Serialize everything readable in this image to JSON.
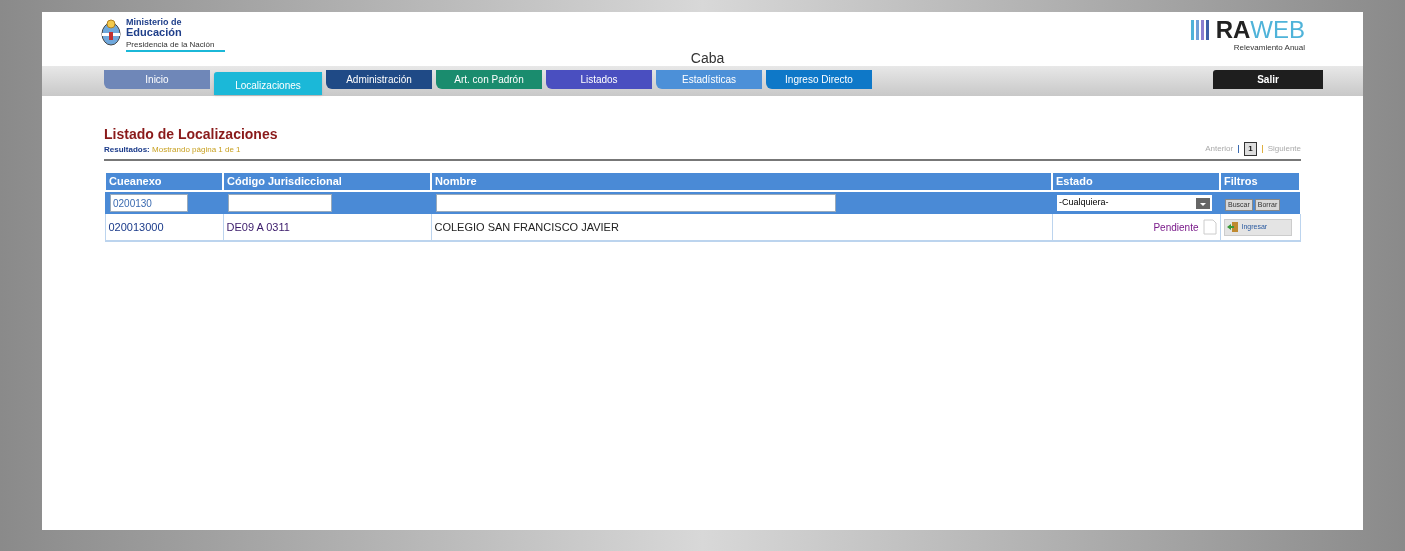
{
  "header": {
    "ministry_line1": "Ministerio de",
    "ministry_line2": "Educación",
    "ministry_line3": "Presidencia de la Nación",
    "title": "Caba",
    "brand_main": "RA",
    "brand_web": "WEB",
    "brand_sub": "Relevamiento Anual"
  },
  "tabs": [
    {
      "label": "Inicio",
      "color": "#6f87b8",
      "selected": false
    },
    {
      "label": "Localizaciones",
      "color": "#1bb8d8",
      "selected": true
    },
    {
      "label": "Administración",
      "color": "#1f4a86",
      "selected": false
    },
    {
      "label": "Art. con Padrón",
      "color": "#1a8c6e",
      "selected": false
    },
    {
      "label": "Listados",
      "color": "#4a4fc0",
      "selected": false
    },
    {
      "label": "Estadísticas",
      "color": "#4c90d8",
      "selected": false
    },
    {
      "label": "Ingreso Directo",
      "color": "#0e78c8",
      "selected": false
    }
  ],
  "logout": "Salir",
  "page_title": "Listado de Localizaciones",
  "results_label": "Resultados:",
  "results_text": "Mostrando página 1 de 1",
  "pagination": {
    "prev": "Anterior",
    "current": "1",
    "next": "Siguiente"
  },
  "table": {
    "columns": [
      "Cueanexo",
      "Código Jurisdiccional",
      "Nombre",
      "Estado",
      "Filtros"
    ],
    "filters": {
      "cueanexo": "0200130",
      "estado": "-Cualquiera-",
      "search_button": "Buscar",
      "clear_button": "Borrar"
    },
    "rows": [
      {
        "cueanexo": "020013000",
        "codigo": "DE09 A 0311",
        "nombre": "COLEGIO SAN FRANCISCO JAVIER",
        "estado": "Pendiente",
        "action": "Ingresar"
      }
    ]
  }
}
